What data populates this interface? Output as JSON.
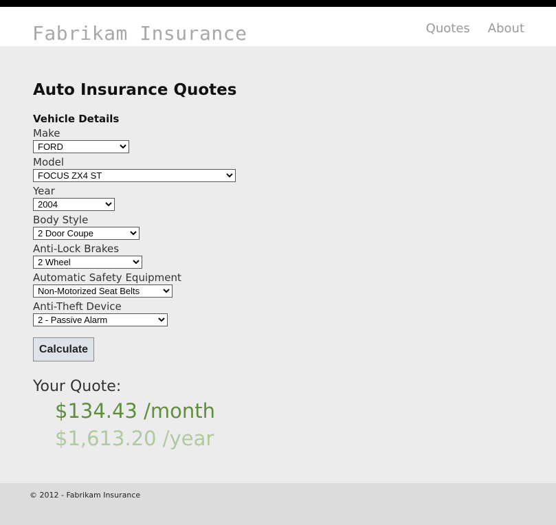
{
  "header": {
    "site_title": "Fabrikam Insurance",
    "nav": [
      "Quotes",
      "About"
    ]
  },
  "main": {
    "page_title": "Auto Insurance Quotes",
    "section_title": "Vehicle Details",
    "fields": {
      "make": {
        "label": "Make",
        "value": "FORD"
      },
      "model": {
        "label": "Model",
        "value": "FOCUS ZX4 ST"
      },
      "year": {
        "label": "Year",
        "value": "2004"
      },
      "body_style": {
        "label": "Body Style",
        "value": "2 Door Coupe"
      },
      "anti_lock_brakes": {
        "label": "Anti-Lock Brakes",
        "value": "2 Wheel"
      },
      "safety_equipment": {
        "label": "Automatic Safety Equipment",
        "value": "Non-Motorized Seat Belts"
      },
      "anti_theft": {
        "label": "Anti-Theft Device",
        "value": "2 - Passive Alarm"
      }
    },
    "calculate_label": "Calculate",
    "quote": {
      "label": "Your Quote:",
      "monthly": "$134.43 /month",
      "yearly": "$1,613.20 /year"
    }
  },
  "footer": {
    "text": "© 2012 - Fabrikam Insurance"
  },
  "colors": {
    "monthly": "#5f8f3e",
    "yearly": "#b0c9a0",
    "background": "#ececec"
  }
}
